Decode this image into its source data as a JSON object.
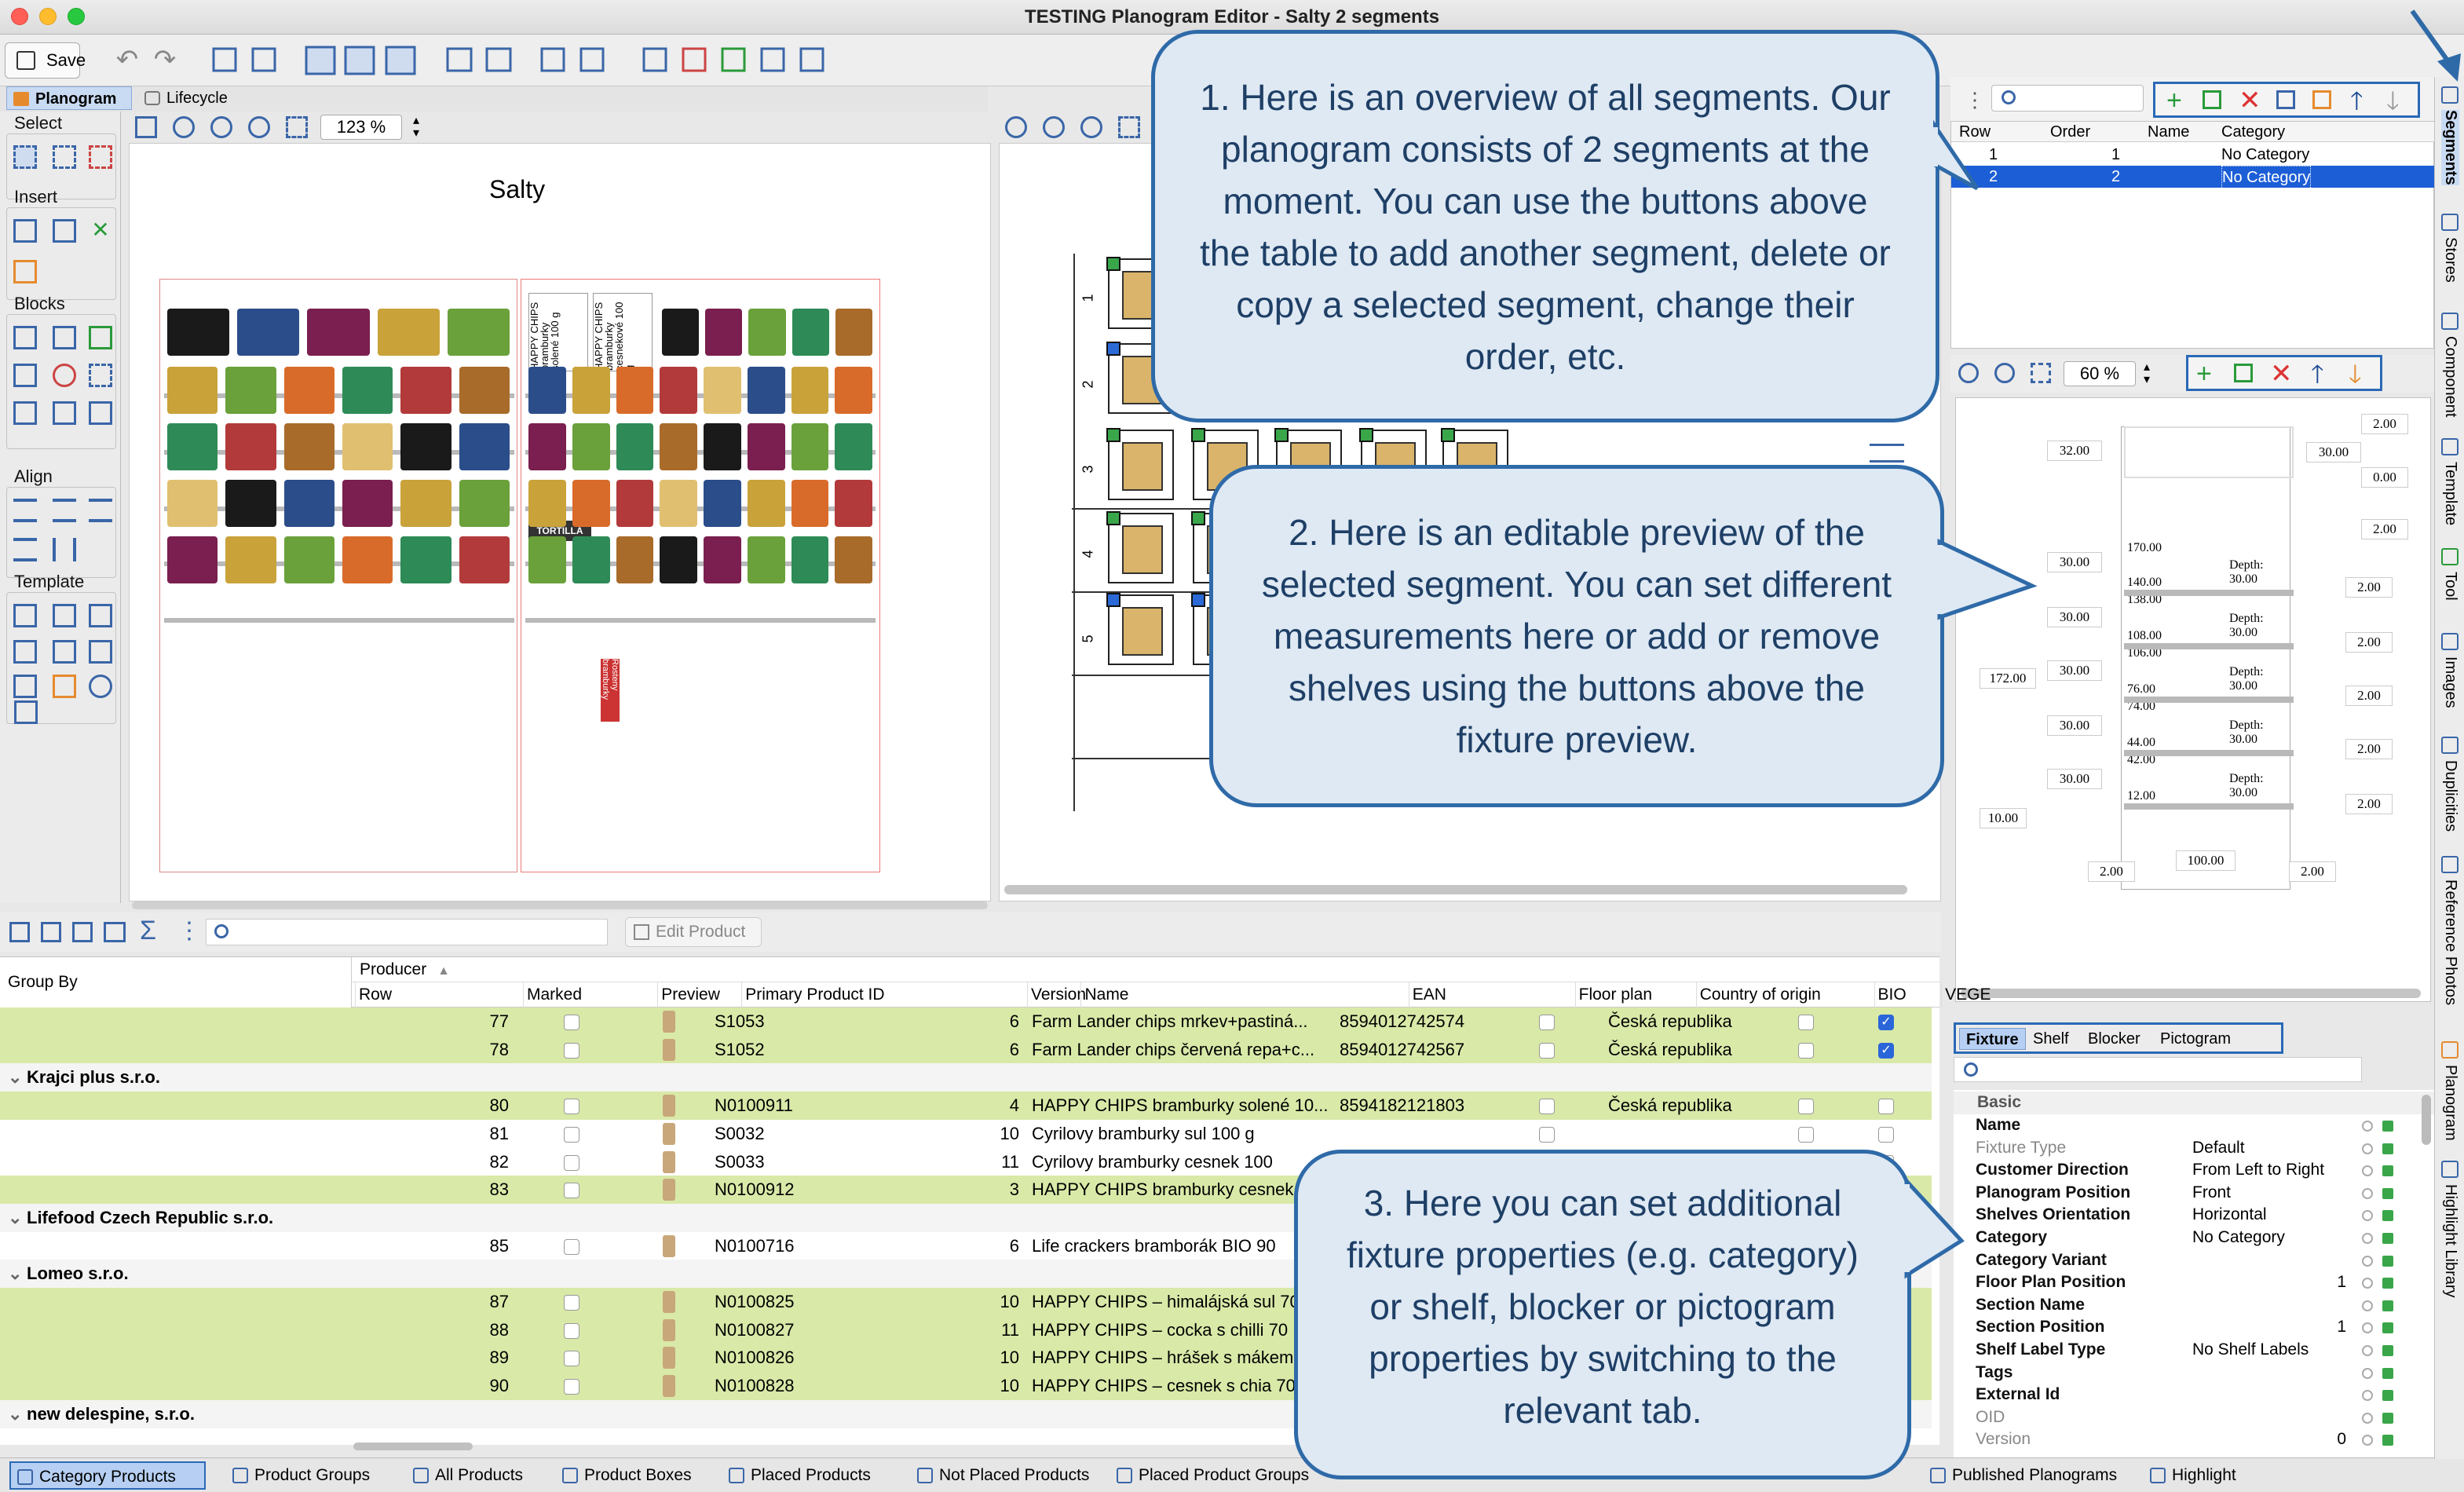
{
  "window": {
    "title": "TESTING Planogram Editor - Salty 2 segments"
  },
  "toolbar": {
    "save_label": "Save"
  },
  "tabs": {
    "planogram": "Planogram",
    "lifecycle": "Lifecycle"
  },
  "palette": {
    "select": "Select",
    "insert": "Insert",
    "blocks": "Blocks",
    "align": "Align",
    "template": "Template"
  },
  "canvas": {
    "zoom": "123 %",
    "title": "Salty"
  },
  "shelf_labels": {
    "s1_a": "HAPPY CHIPS bramburky solené 100 g",
    "s1_b": "HAPPY CHIPS bramburky cesnekové 100 g",
    "s3_a": "TORTILLA CHIPS",
    "s4_a": "Rosteny bramburky"
  },
  "row_numbers": [
    "1",
    "2",
    "3",
    "4",
    "5"
  ],
  "segments": {
    "columns": [
      "Row",
      "Order",
      "Name",
      "Category"
    ],
    "rows": [
      {
        "row": "1",
        "order": "1",
        "name": "",
        "category": "No Category"
      },
      {
        "row": "2",
        "order": "2",
        "name": "",
        "category": "No Category"
      }
    ]
  },
  "preview": {
    "zoom": "60 %",
    "left_vals": [
      "32.00",
      "30.00",
      "30.00",
      "30.00",
      "30.00",
      "30.00"
    ],
    "height_total": "172.00",
    "inner_vals": [
      "170.00",
      "140.00",
      "138.00",
      "108.00",
      "106.00",
      "76.00",
      "74.00",
      "44.00",
      "42.00",
      "12.00"
    ],
    "depths": [
      "Depth: 30.00",
      "Depth: 30.00",
      "Depth: 30.00",
      "Depth: 30.00",
      "Depth: 30.00"
    ],
    "right_vals": [
      "2.00",
      "30.00",
      "0.00",
      "2.00",
      "2.00",
      "2.00",
      "2.00",
      "2.00",
      "2.00"
    ],
    "bottom_left": "10.00",
    "bottom_vals": [
      "2.00",
      "100.00",
      "2.00"
    ]
  },
  "prop_tabs": [
    "Fixture",
    "Shelf",
    "Blocker",
    "Pictogram"
  ],
  "properties": {
    "section": "Basic",
    "items": [
      {
        "name": "Name",
        "value": "",
        "bold": true
      },
      {
        "name": "Fixture Type",
        "value": "Default",
        "bold": false
      },
      {
        "name": "Customer Direction",
        "value": "From Left to Right",
        "bold": true
      },
      {
        "name": "Planogram Position",
        "value": "Front",
        "bold": true
      },
      {
        "name": "Shelves Orientation",
        "value": "Horizontal",
        "bold": true
      },
      {
        "name": "Category",
        "value": "No Category",
        "bold": true
      },
      {
        "name": "Category Variant",
        "value": "",
        "bold": true
      },
      {
        "name": "Floor Plan Position",
        "value": "1",
        "bold": true
      },
      {
        "name": "Section Name",
        "value": "",
        "bold": true
      },
      {
        "name": "Section Position",
        "value": "1",
        "bold": true
      },
      {
        "name": "Shelf Label Type",
        "value": "No Shelf Labels",
        "bold": true
      },
      {
        "name": "Tags",
        "value": "",
        "bold": true
      },
      {
        "name": "External Id",
        "value": "",
        "bold": true
      },
      {
        "name": "OID",
        "value": "",
        "bold": false
      },
      {
        "name": "Version",
        "value": "0",
        "bold": false
      }
    ]
  },
  "bottom_toolbar": {
    "edit_product": "Edit Product"
  },
  "grid": {
    "group_by": "Group By",
    "producer_header": "Producer",
    "columns": [
      "Row",
      "Marked",
      "Preview",
      "Primary Product ID",
      "Version",
      "Name",
      "EAN",
      "Floor plan",
      "Country of origin",
      "BIO",
      "VEGE"
    ],
    "rows": [
      {
        "type": "item",
        "row": "77",
        "id": "S1053",
        "version": "6",
        "name": "Farm Lander chips mrkev+pastiná...",
        "ean": "8594012742574",
        "country": "Česká republika",
        "vege": true,
        "green": true
      },
      {
        "type": "item",
        "row": "78",
        "id": "S1052",
        "version": "6",
        "name": "Farm Lander chips červená repa+c...",
        "ean": "8594012742567",
        "country": "Česká republika",
        "vege": true,
        "green": true
      },
      {
        "type": "group",
        "label": "Krajci plus s.r.o."
      },
      {
        "type": "item",
        "row": "80",
        "id": "N0100911",
        "version": "4",
        "name": "HAPPY CHIPS bramburky solené 10...",
        "ean": "8594182121803",
        "country": "Česká republika",
        "vege": false,
        "green": true
      },
      {
        "type": "item",
        "row": "81",
        "id": "S0032",
        "version": "10",
        "name": "Cyrilovy bramburky sul 100 g",
        "ean": "",
        "country": "",
        "vege": false,
        "green": false
      },
      {
        "type": "item",
        "row": "82",
        "id": "S0033",
        "version": "11",
        "name": "Cyrilovy bramburky cesnek 100",
        "ean": "",
        "country": "",
        "vege": false,
        "green": false
      },
      {
        "type": "item",
        "row": "83",
        "id": "N0100912",
        "version": "3",
        "name": "HAPPY CHIPS bramburky cesnek",
        "ean": "",
        "country": "",
        "vege": false,
        "green": true
      },
      {
        "type": "group",
        "label": "Lifefood Czech Republic s.r.o."
      },
      {
        "type": "item",
        "row": "85",
        "id": "N0100716",
        "version": "6",
        "name": "Life crackers bramborák BIO 90",
        "ean": "",
        "country": "",
        "vege": false,
        "green": false
      },
      {
        "type": "group",
        "label": "Lomeo s.r.o."
      },
      {
        "type": "item",
        "row": "87",
        "id": "N0100825",
        "version": "10",
        "name": "HAPPY CHIPS – himalájská sul 70",
        "ean": "",
        "country": "",
        "vege": false,
        "green": true
      },
      {
        "type": "item",
        "row": "88",
        "id": "N0100827",
        "version": "11",
        "name": "HAPPY CHIPS – cocka s chilli 70",
        "ean": "",
        "country": "",
        "vege": false,
        "green": true
      },
      {
        "type": "item",
        "row": "89",
        "id": "N0100826",
        "version": "10",
        "name": "HAPPY CHIPS – hrášek s mákem",
        "ean": "",
        "country": "",
        "vege": false,
        "green": true
      },
      {
        "type": "item",
        "row": "90",
        "id": "N0100828",
        "version": "10",
        "name": "HAPPY CHIPS – cesnek s chia 70",
        "ean": "",
        "country": "",
        "vege": false,
        "green": true
      },
      {
        "type": "group",
        "label": "new delespine, s.r.o."
      }
    ]
  },
  "status_tabs": [
    "Category Products",
    "Product Groups",
    "All Products",
    "Product Boxes",
    "Placed Products",
    "Not Placed Products",
    "Placed Product Groups",
    "Published Planograms",
    "Highlight"
  ],
  "vertical_tabs": [
    "Segments",
    "Stores",
    "Component",
    "Template",
    "Tool",
    "Images",
    "Duplicities",
    "Reference Photos",
    "Planogram",
    "Highlight Library"
  ],
  "callouts": {
    "c1": "1. Here is an overview of all segments. Our planogram consists of 2 segments at the moment. You can use the buttons above the table to add another segment, delete or copy a selected segment, change their order, etc.",
    "c2": "2. Here is an editable preview of the selected segment. You can set different measurements here or add or remove shelves using the buttons above the fixture preview.",
    "c3": "3. Here you can set additional fixture properties (e.g. category) or shelf, blocker or pictogram properties by switching to the relevant tab."
  },
  "colors": {
    "accent": "#2a69b6",
    "selection": "#1c5ed6",
    "green_row": "#d9e9a8",
    "callout_bg": "#dfe9f3"
  }
}
